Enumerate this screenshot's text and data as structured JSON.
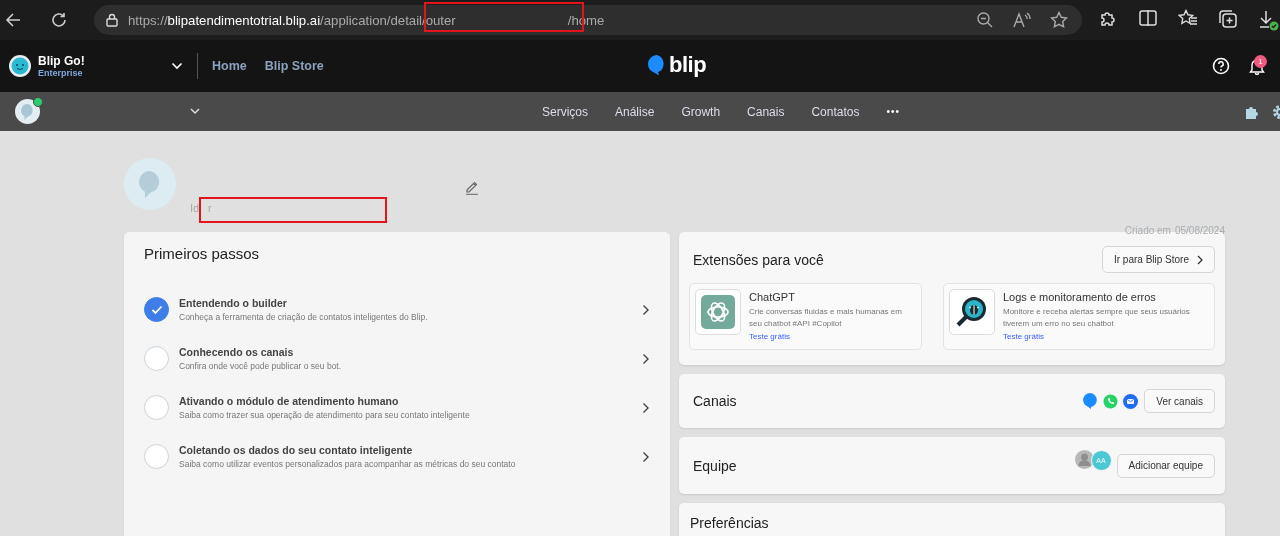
{
  "browser": {
    "url_scheme": "https://",
    "url_host": "blipatendimentotrial.blip.ai",
    "url_path": "/application/detail/",
    "url_fragment": "outer",
    "url_tail": "/home"
  },
  "header": {
    "workspace": "Blip Go!",
    "plan": "Enterprise",
    "nav": [
      {
        "label": "Home"
      },
      {
        "label": "Blip Store"
      }
    ],
    "logo": "blip",
    "notifications": "1"
  },
  "subnav": {
    "items": [
      {
        "label": "Serviços"
      },
      {
        "label": "Análise"
      },
      {
        "label": "Growth"
      },
      {
        "label": "Canais"
      },
      {
        "label": "Contatos"
      }
    ],
    "more": "•••"
  },
  "profile": {
    "id_label": "Id",
    "id_fragment": "r",
    "created_label": "Criado em",
    "created_date": "05/08/2024"
  },
  "steps": {
    "title": "Primeiros passos",
    "items": [
      {
        "title": "Entendendo o builder",
        "description": "Conheça a ferramenta de criação de contatos inteligentes do Blip.",
        "checked": true
      },
      {
        "title": "Conhecendo os canais",
        "description": "Confira onde você pode publicar o seu bot.",
        "checked": false
      },
      {
        "title": "Ativando o módulo de atendimento humano",
        "description": "Saiba como trazer sua operação de atendimento para seu contato inteligente",
        "checked": false
      },
      {
        "title": "Coletando os dados do seu contato inteligente",
        "description": "Saiba como utilizar eventos personalizados para acompanhar as métricas do seu contato",
        "checked": false
      }
    ]
  },
  "extensions": {
    "title": "Extensões para você",
    "button": "Ir para Blip Store",
    "items": [
      {
        "name": "ChatGPT",
        "description": "Crie conversas fluidas e mais humanas em seu chatbot #API #Copilot",
        "link": "Teste grátis"
      },
      {
        "name": "Logs e monitoramento de erros",
        "description": "Monitore e receba alertas sempre que seus usuários tiverem um erro no seu chatbot",
        "link": "Teste grátis"
      }
    ]
  },
  "channels": {
    "title": "Canais",
    "button": "Ver canais"
  },
  "team": {
    "title": "Equipe",
    "avatar_initials": "AA",
    "button": "Adicionar equipe"
  },
  "preferences": {
    "title": "Preferências"
  }
}
